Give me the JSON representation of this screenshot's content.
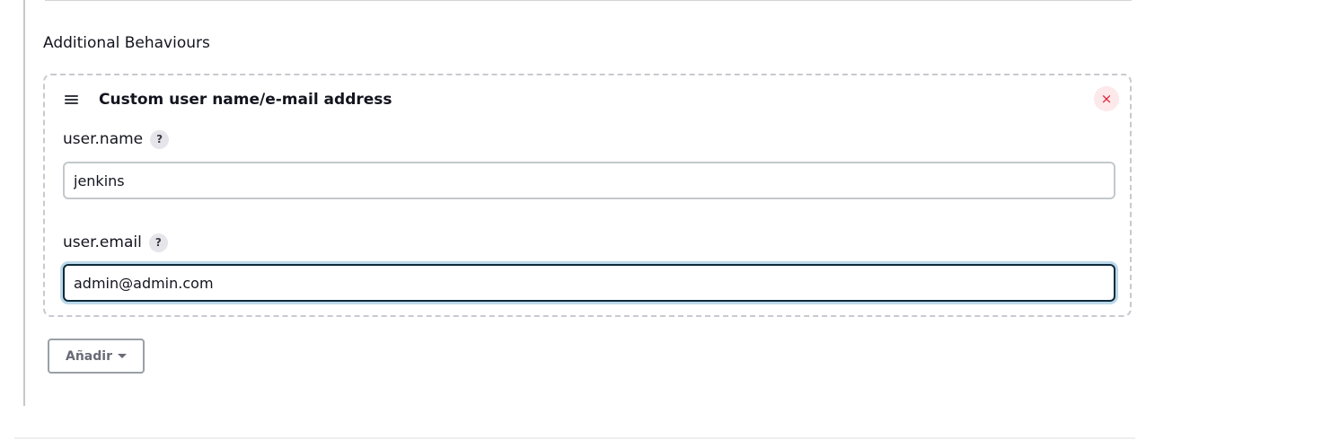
{
  "section": {
    "title": "Additional Behaviours"
  },
  "behaviour": {
    "title": "Custom user name/e-mail address",
    "delete_symbol": "×",
    "fields": [
      {
        "label": "user.name",
        "help": "?",
        "value": "jenkins"
      },
      {
        "label": "user.email",
        "help": "?",
        "value": "admin@admin.com",
        "focused": true
      }
    ]
  },
  "actions": {
    "add_label": "Añadir"
  },
  "icons": {
    "drag": "drag-handle-icon",
    "delete": "close-icon",
    "help": "help-icon",
    "dropdown": "chevron-down-icon"
  },
  "colors": {
    "delete_bg": "#fde8ea",
    "delete_fg": "#e11d34",
    "focus_ring": "#bcd9ea",
    "focus_border": "#0d2a3a"
  }
}
